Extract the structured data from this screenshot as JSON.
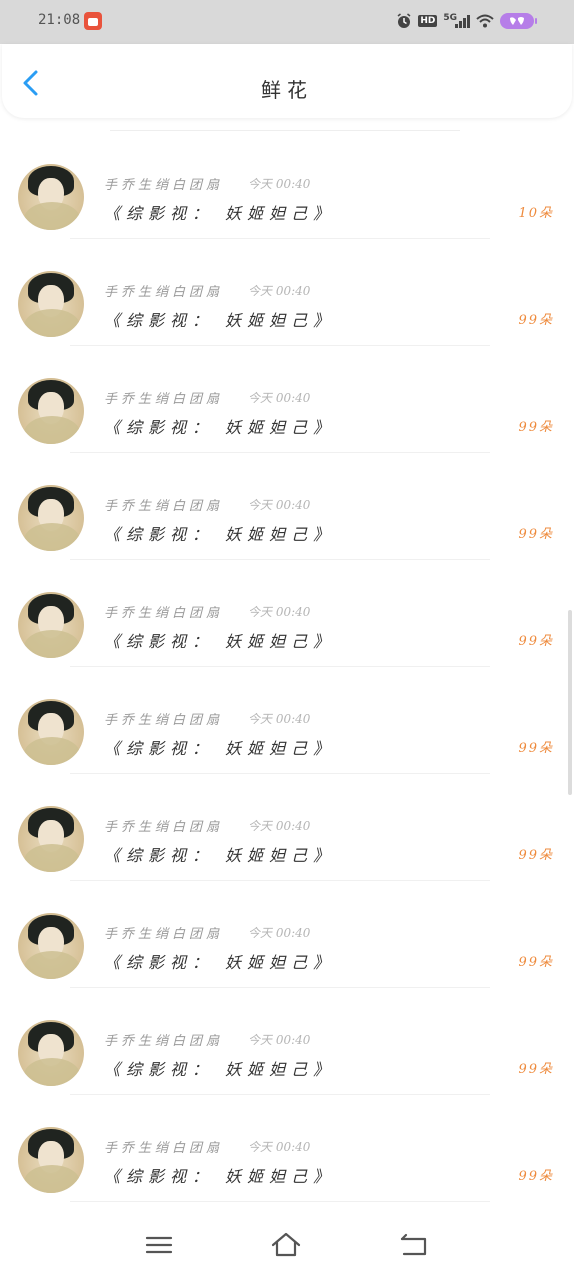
{
  "status_bar": {
    "time": "21:08",
    "icons": [
      "notification-app-icon",
      "alarm-icon",
      "hd-icon",
      "5g-signal-icon",
      "wifi-icon",
      "battery-icon"
    ],
    "hd_label": "HD",
    "network_label": "5G"
  },
  "header": {
    "title": "鲜花",
    "back_icon": "chevron-left-icon",
    "accent_color": "#2a9df4"
  },
  "list": {
    "items": [
      {
        "name": "手乔生绡白团扇",
        "time": "今天 00:40",
        "message": "《综影视： 妖姬妲己》",
        "count": "10朵"
      },
      {
        "name": "手乔生绡白团扇",
        "time": "今天 00:40",
        "message": "《综影视： 妖姬妲己》",
        "count": "99朵"
      },
      {
        "name": "手乔生绡白团扇",
        "time": "今天 00:40",
        "message": "《综影视： 妖姬妲己》",
        "count": "99朵"
      },
      {
        "name": "手乔生绡白团扇",
        "time": "今天 00:40",
        "message": "《综影视： 妖姬妲己》",
        "count": "99朵"
      },
      {
        "name": "手乔生绡白团扇",
        "time": "今天 00:40",
        "message": "《综影视： 妖姬妲己》",
        "count": "99朵"
      },
      {
        "name": "手乔生绡白团扇",
        "time": "今天 00:40",
        "message": "《综影视： 妖姬妲己》",
        "count": "99朵"
      },
      {
        "name": "手乔生绡白团扇",
        "time": "今天 00:40",
        "message": "《综影视： 妖姬妲己》",
        "count": "99朵"
      },
      {
        "name": "手乔生绡白团扇",
        "time": "今天 00:40",
        "message": "《综影视： 妖姬妲己》",
        "count": "99朵"
      },
      {
        "name": "手乔生绡白团扇",
        "time": "今天 00:40",
        "message": "《综影视： 妖姬妲己》",
        "count": "99朵"
      },
      {
        "name": "手乔生绡白团扇",
        "time": "今天 00:40",
        "message": "《综影视： 妖姬妲己》",
        "count": "99朵"
      }
    ],
    "count_color": "#ee8a3c"
  },
  "nav_bar": {
    "buttons": [
      "menu-icon",
      "home-icon",
      "back-icon"
    ]
  }
}
